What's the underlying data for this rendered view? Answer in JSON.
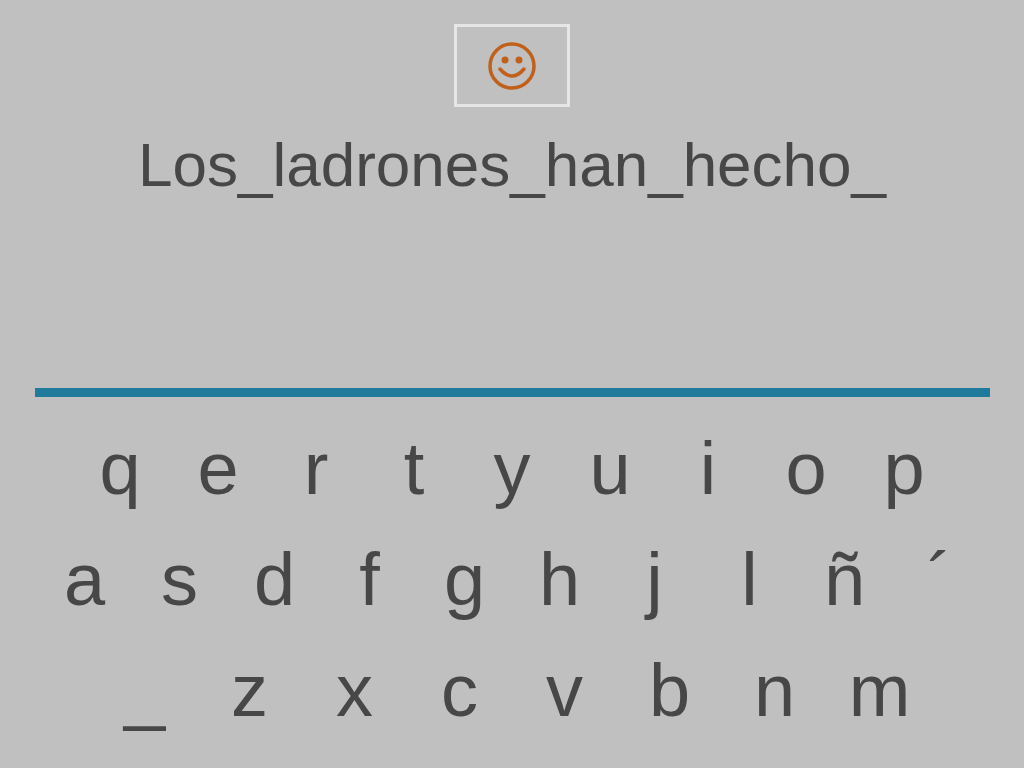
{
  "sentence": "Los_ladrones_han_hecho_",
  "keyboard": {
    "rows": [
      {
        "keys": [
          "q",
          "e",
          "r",
          "t",
          "y",
          "u",
          "i",
          "o",
          "p"
        ]
      },
      {
        "keys": [
          "a",
          "s",
          "d",
          "f",
          "g",
          "h",
          "j",
          "l",
          "ñ",
          "´"
        ]
      },
      {
        "keys": [
          "_",
          "z",
          "x",
          "c",
          "v",
          "b",
          "n",
          "m"
        ]
      }
    ]
  }
}
